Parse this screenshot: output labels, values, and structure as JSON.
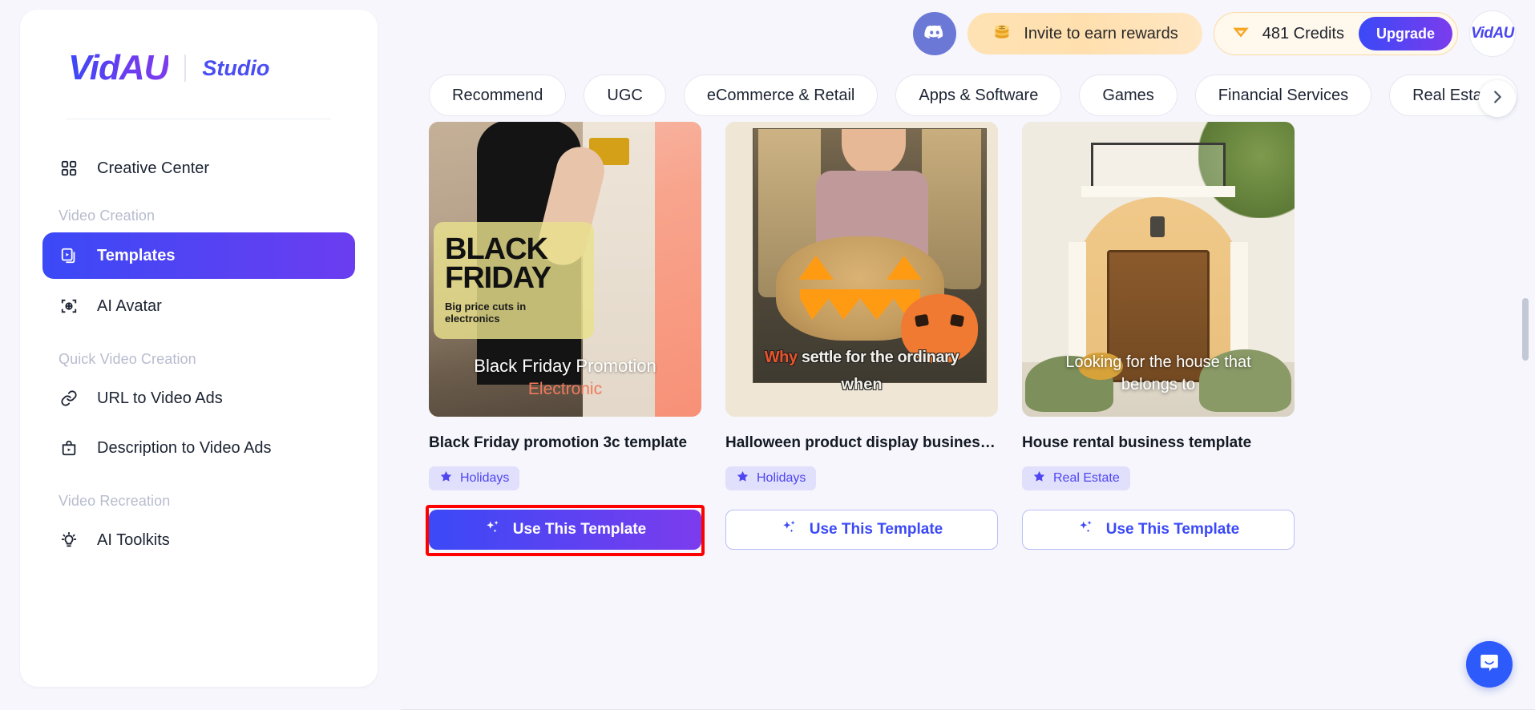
{
  "brand": {
    "logo": "VidAU",
    "sub": "Studio"
  },
  "sidebar": {
    "top_items": [
      {
        "label": "Creative Center",
        "icon": "grid-icon"
      }
    ],
    "groups": [
      {
        "label": "Video Creation",
        "items": [
          {
            "label": "Templates",
            "icon": "templates-icon",
            "active": true
          },
          {
            "label": "AI Avatar",
            "icon": "ai-avatar-icon",
            "active": false
          }
        ]
      },
      {
        "label": "Quick Video Creation",
        "items": [
          {
            "label": "URL to Video Ads",
            "icon": "link-icon",
            "active": false
          },
          {
            "label": "Description to Video Ads",
            "icon": "bag-play-icon",
            "active": false
          }
        ]
      },
      {
        "label": "Video Recreation",
        "items": [
          {
            "label": "AI Toolkits",
            "icon": "lightbulb-icon",
            "active": false
          }
        ]
      }
    ]
  },
  "header": {
    "discord_icon": "discord-icon",
    "invite_label": "Invite to earn rewards",
    "invite_icon": "coins-icon",
    "credits_label": "481 Credits",
    "credits_icon": "gem-icon",
    "upgrade_label": "Upgrade",
    "avatar_text": "VidAU"
  },
  "tabs": [
    {
      "label": "Recommend",
      "active": false
    },
    {
      "label": "UGC",
      "active": false
    },
    {
      "label": "eCommerce & Retail",
      "active": false
    },
    {
      "label": "Apps & Software",
      "active": false
    },
    {
      "label": "Games",
      "active": false
    },
    {
      "label": "Financial Services",
      "active": false
    },
    {
      "label": "Real Estate",
      "active": false
    }
  ],
  "tabs_next_icon": "chevron-right-icon",
  "cards": [
    {
      "title": "Black Friday promotion 3c template",
      "tag": "Holidays",
      "tag_icon": "star-icon",
      "button_label": "Use This Template",
      "button_icon": "sparkles-icon",
      "button_style": "primary",
      "highlighted": true,
      "art": {
        "headline_line1": "BLACK",
        "headline_line2": "FRIDAY",
        "subhead": "Big price cuts in electronics",
        "caption1": "Black Friday Promotion",
        "caption2": "Electronic"
      }
    },
    {
      "title": "Halloween product display business t…",
      "tag": "Holidays",
      "tag_icon": "star-icon",
      "button_label": "Use This Template",
      "button_icon": "sparkles-icon",
      "button_style": "outline",
      "highlighted": false,
      "art": {
        "caption_highlight": "Why",
        "caption_rest": " settle for the ordinary",
        "caption2": "when"
      }
    },
    {
      "title": "House rental business template",
      "tag": "Real Estate",
      "tag_icon": "star-icon",
      "button_label": "Use This Template",
      "button_icon": "sparkles-icon",
      "button_style": "outline",
      "highlighted": false,
      "art": {
        "caption1": "Looking for the house that",
        "caption2": "belongs to"
      }
    }
  ],
  "chat": {
    "icon": "intercom-chat-icon"
  },
  "colors": {
    "accent": "#3b49f6",
    "accent_purple": "#7b3ced",
    "credit_orange": "#f5a623",
    "highlight_red": "#ff0000"
  }
}
